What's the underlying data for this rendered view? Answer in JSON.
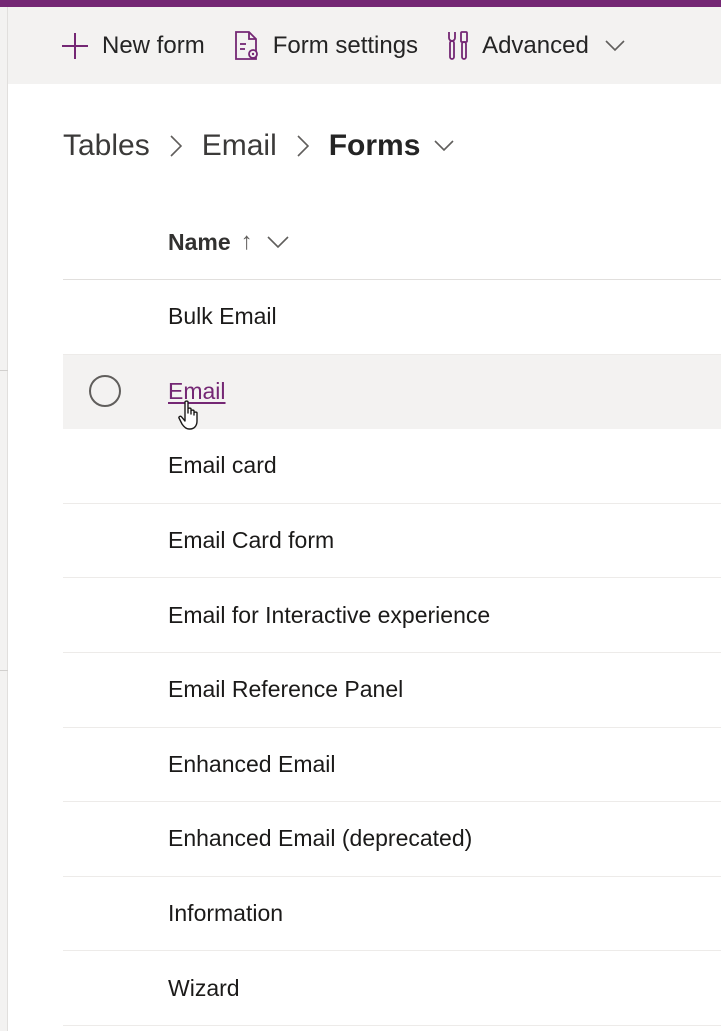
{
  "command_bar": {
    "new_form": {
      "label": "New form",
      "icon": "plus-icon"
    },
    "form_settings": {
      "label": "Form settings",
      "icon": "form-settings-icon"
    },
    "advanced": {
      "label": "Advanced",
      "icon": "tools-icon"
    }
  },
  "breadcrumb": {
    "items": [
      "Tables",
      "Email"
    ],
    "current": "Forms"
  },
  "grid": {
    "column_header": "Name",
    "sort_indicator": "↑",
    "rows": [
      {
        "name": "Bulk Email"
      },
      {
        "name": "Email",
        "hovered": true
      },
      {
        "name": "Email card"
      },
      {
        "name": "Email Card form"
      },
      {
        "name": "Email for Interactive experience"
      },
      {
        "name": "Email Reference Panel"
      },
      {
        "name": "Enhanced Email"
      },
      {
        "name": "Enhanced Email (deprecated)"
      },
      {
        "name": "Information"
      },
      {
        "name": "Wizard"
      }
    ]
  },
  "colors": {
    "accent": "#742774",
    "command_bar_bg": "#f3f2f1",
    "row_hover_bg": "#f3f2f1"
  }
}
